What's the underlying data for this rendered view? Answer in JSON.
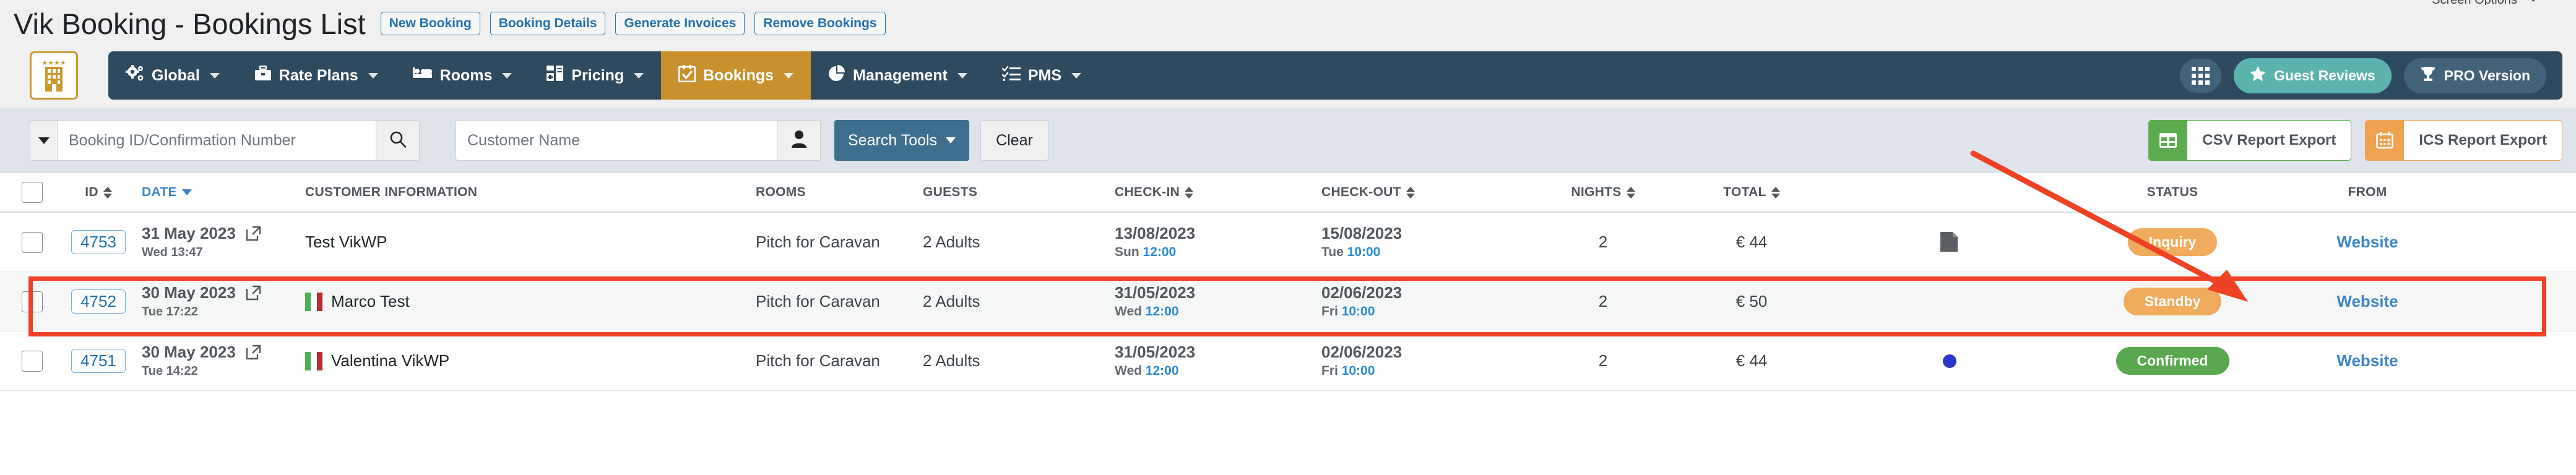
{
  "screen_options": {
    "label": "Screen Options",
    "icon": "chevron-up-icon"
  },
  "header": {
    "title": "Vik Booking - Bookings List",
    "buttons": [
      {
        "label": "New Booking",
        "name": "new-booking-button"
      },
      {
        "label": "Booking Details",
        "name": "booking-details-button"
      },
      {
        "label": "Generate Invoices",
        "name": "generate-invoices-button"
      },
      {
        "label": "Remove Bookings",
        "name": "remove-bookings-button"
      }
    ]
  },
  "nav": {
    "logo_icon": "hotel-building-icon",
    "items": [
      {
        "label": "Global",
        "icon": "gears-icon",
        "active": false
      },
      {
        "label": "Rate Plans",
        "icon": "briefcase-icon",
        "active": false
      },
      {
        "label": "Rooms",
        "icon": "bed-icon",
        "active": false
      },
      {
        "label": "Pricing",
        "icon": "calculator-icon",
        "active": false
      },
      {
        "label": "Bookings",
        "icon": "calendar-check-icon",
        "active": true
      },
      {
        "label": "Management",
        "icon": "pie-chart-icon",
        "active": false
      },
      {
        "label": "PMS",
        "icon": "tasks-list-icon",
        "active": false
      }
    ],
    "right": {
      "apps_icon": "grid-apps-icon",
      "guest_reviews": {
        "label": "Guest Reviews",
        "icon": "star-icon"
      },
      "pro_version": {
        "label": "PRO Version",
        "icon": "trophy-icon"
      }
    }
  },
  "toolbar": {
    "filter_dropdown_icon": "caret-down-icon",
    "booking_id_placeholder": "Booking ID/Confirmation Number",
    "booking_id_value": "",
    "search_icon": "search-icon",
    "customer_name_placeholder": "Customer Name",
    "customer_name_value": "",
    "customer_icon": "user-icon",
    "search_tools_label": "Search Tools",
    "clear_label": "Clear",
    "csv_export_label": "CSV Report Export",
    "csv_export_icon": "table-grid-icon",
    "ics_export_label": "ICS Report Export",
    "ics_export_icon": "calendar-icon"
  },
  "table": {
    "columns": [
      {
        "key": "check",
        "label": ""
      },
      {
        "key": "id",
        "label": "ID",
        "sortable": true,
        "sorted": false
      },
      {
        "key": "date",
        "label": "DATE",
        "sortable": true,
        "sorted": true
      },
      {
        "key": "cust",
        "label": "CUSTOMER INFORMATION",
        "sortable": false
      },
      {
        "key": "rooms",
        "label": "ROOMS",
        "sortable": false
      },
      {
        "key": "guests",
        "label": "GUESTS",
        "sortable": false
      },
      {
        "key": "in",
        "label": "CHECK-IN",
        "sortable": true,
        "sorted": false
      },
      {
        "key": "out",
        "label": "CHECK-OUT",
        "sortable": true,
        "sorted": false
      },
      {
        "key": "nights",
        "label": "NIGHTS",
        "sortable": true,
        "sorted": false
      },
      {
        "key": "total",
        "label": "TOTAL",
        "sortable": true,
        "sorted": false
      },
      {
        "key": "note",
        "label": ""
      },
      {
        "key": "status",
        "label": "STATUS",
        "sortable": false
      },
      {
        "key": "from",
        "label": "FROM",
        "sortable": false
      }
    ],
    "rows": [
      {
        "id": "4753",
        "date_main": "31 May 2023",
        "date_sub": "Wed 13:47",
        "customer": "Test VikWP",
        "flag": "none",
        "rooms": "Pitch for Caravan",
        "guests": "2 Adults",
        "checkin_date": "13/08/2023",
        "checkin_day": "Sun",
        "checkin_time": "12:00",
        "checkout_date": "15/08/2023",
        "checkout_day": "Tue",
        "checkout_time": "10:00",
        "nights": "2",
        "total": "€ 44",
        "note_icon": "note-icon",
        "marker": "none",
        "status": "Inquiry",
        "status_color": "#f0ab5c",
        "from": "Website",
        "highlighted": true
      },
      {
        "id": "4752",
        "date_main": "30 May 2023",
        "date_sub": "Tue 17:22",
        "customer": "Marco Test",
        "flag": "italy",
        "rooms": "Pitch for Caravan",
        "guests": "2 Adults",
        "checkin_date": "31/05/2023",
        "checkin_day": "Wed",
        "checkin_time": "12:00",
        "checkout_date": "02/06/2023",
        "checkout_day": "Fri",
        "checkout_time": "10:00",
        "nights": "2",
        "total": "€ 50",
        "note_icon": "none",
        "marker": "none",
        "status": "Standby",
        "status_color": "#f0ab5c",
        "from": "Website",
        "highlighted": false
      },
      {
        "id": "4751",
        "date_main": "30 May 2023",
        "date_sub": "Tue 14:22",
        "customer": "Valentina VikWP",
        "flag": "italy",
        "rooms": "Pitch for Caravan",
        "guests": "2 Adults",
        "checkin_date": "31/05/2023",
        "checkin_day": "Wed",
        "checkin_time": "12:00",
        "checkout_date": "02/06/2023",
        "checkout_day": "Fri",
        "checkout_time": "10:00",
        "nights": "2",
        "total": "€ 44",
        "note_icon": "none",
        "marker": "blue-dot",
        "status": "Confirmed",
        "status_color": "#59a84f",
        "from": "Website",
        "highlighted": false
      }
    ]
  },
  "annotation": {
    "type": "arrow",
    "color": "#ef4124",
    "highlight_color": "#ef4124",
    "target": "status-badge-row-1"
  }
}
